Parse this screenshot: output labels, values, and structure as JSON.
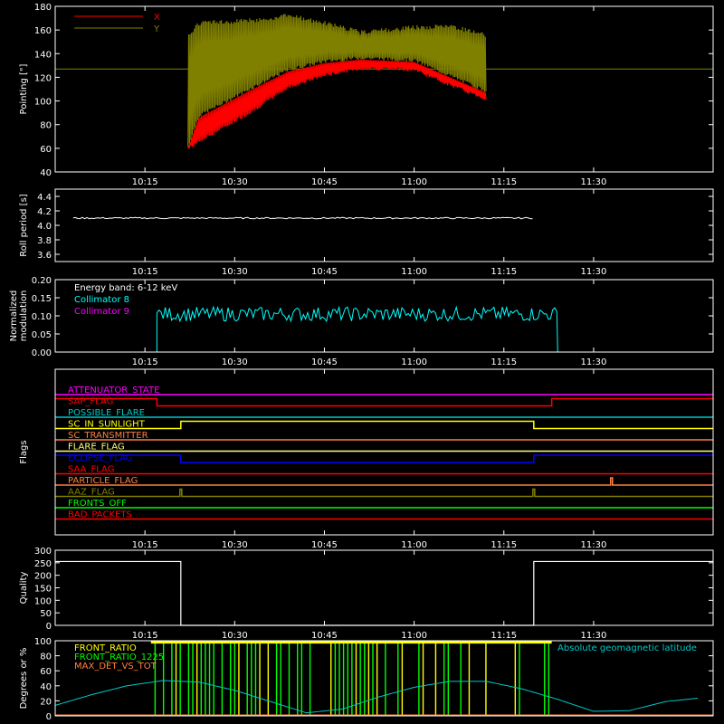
{
  "chart_data": [
    {
      "id": "pointing",
      "type": "line",
      "title": "",
      "ylabel": "Pointing [\"]",
      "ylim": [
        40,
        180
      ],
      "yticks": [
        40,
        60,
        80,
        100,
        120,
        140,
        160,
        180
      ],
      "xlim_minutes": [
        0,
        720
      ],
      "xticks": [
        "10:15",
        "10:30",
        "10:45",
        "11:00",
        "11:15",
        "11:30"
      ],
      "legend": [
        {
          "name": "X",
          "color": "#ff0000"
        },
        {
          "name": "Y",
          "color": "#808000"
        }
      ],
      "reference_line": 127,
      "series": [
        {
          "name": "Y",
          "color": "#808000",
          "upper_envelope": [
            [
              10.37,
              156
            ],
            [
              10.4,
              168
            ],
            [
              10.55,
              170
            ],
            [
              10.65,
              174
            ],
            [
              10.75,
              168
            ],
            [
              10.85,
              160
            ],
            [
              11.0,
              164
            ],
            [
              11.1,
              165
            ],
            [
              11.2,
              158
            ]
          ],
          "lower_envelope": [
            [
              10.37,
              60
            ],
            [
              10.4,
              86
            ],
            [
              10.55,
              110
            ],
            [
              10.65,
              125
            ],
            [
              10.75,
              132
            ],
            [
              10.85,
              135
            ],
            [
              11.0,
              133
            ],
            [
              11.1,
              120
            ],
            [
              11.2,
              107
            ]
          ]
        },
        {
          "name": "X",
          "color": "#ff0000",
          "upper_envelope": [
            [
              10.37,
              60
            ],
            [
              10.4,
              86
            ],
            [
              10.55,
              110
            ],
            [
              10.65,
              125
            ],
            [
              10.75,
              132
            ],
            [
              10.85,
              135
            ],
            [
              11.0,
              133
            ],
            [
              11.1,
              120
            ],
            [
              11.2,
              107
            ]
          ],
          "lower_envelope": [
            [
              10.37,
              58
            ],
            [
              10.4,
              64
            ],
            [
              10.55,
              90
            ],
            [
              10.65,
              110
            ],
            [
              10.75,
              120
            ],
            [
              10.85,
              126
            ],
            [
              11.0,
              125
            ],
            [
              11.1,
              112
            ],
            [
              11.2,
              100
            ]
          ]
        }
      ]
    },
    {
      "id": "roll",
      "type": "line",
      "ylabel": "Roll period [s]",
      "ylim": [
        3.5,
        4.5
      ],
      "yticks": [
        3.6,
        3.8,
        4.0,
        4.2,
        4.4
      ],
      "xticks": [
        "10:15",
        "10:30",
        "10:45",
        "11:00",
        "11:15",
        "11:30"
      ],
      "series": [
        {
          "name": "",
          "color": "#ffffff",
          "x_hours": [
            10.15,
            10.35,
            10.55,
            10.75,
            10.95,
            11.15,
            11.33
          ],
          "values": [
            4.1,
            4.1,
            4.1,
            4.1,
            4.1,
            4.1,
            4.1
          ]
        }
      ]
    },
    {
      "id": "modulation",
      "type": "line",
      "ylabel": "Normalized modulation",
      "ylim": [
        0,
        0.2
      ],
      "yticks": [
        0.0,
        0.05,
        0.1,
        0.15,
        0.2
      ],
      "xticks": [
        "10:15",
        "10:30",
        "10:45",
        "11:00",
        "11:15",
        "11:30"
      ],
      "annotation": "Energy band: 6-12 keV",
      "legend": [
        {
          "name": "Collimator 8",
          "color": "#00ffff"
        },
        {
          "name": "Collimator 9",
          "color": "#ff00ff"
        }
      ],
      "series": [
        {
          "name": "Collimator 8",
          "color": "#00ffff",
          "start": "10:17",
          "end": "11:24",
          "mean": 0.105,
          "range": [
            0.085,
            0.125
          ]
        },
        {
          "name": "Collimator 9",
          "color": "#ff00ff",
          "values": [
            0,
            0
          ]
        }
      ]
    },
    {
      "id": "flags",
      "type": "line",
      "ylabel": "Flags",
      "xticks": [
        "10:15",
        "10:30",
        "10:45",
        "11:00",
        "11:15",
        "11:30"
      ],
      "flags": [
        {
          "name": "ATTENUATOR_STATE",
          "color": "#ff00ff",
          "steps": []
        },
        {
          "name": "SAP_FLAG",
          "color": "#ff0000",
          "steps": [
            [
              "10:00",
              "10:17",
              1
            ],
            [
              "10:17",
              "11:23",
              0
            ],
            [
              "11:23",
              "11:50",
              1
            ]
          ]
        },
        {
          "name": "POSSIBLE_FLARE",
          "color": "#00c8c8",
          "steps": []
        },
        {
          "name": "SC_IN_SUNLIGHT",
          "color": "#ffff00",
          "steps": [
            [
              "10:00",
              "10:21",
              0
            ],
            [
              "10:21",
              "11:20",
              1
            ],
            [
              "11:20",
              "11:50",
              0
            ]
          ]
        },
        {
          "name": "SC_TRANSMITTER",
          "color": "#ff8040",
          "steps": []
        },
        {
          "name": "FLARE_FLAG",
          "color": "#ffff80",
          "steps": []
        },
        {
          "name": "ECLIPSE_FLAG",
          "color": "#0000ff",
          "steps": [
            [
              "10:00",
              "10:21",
              1
            ],
            [
              "10:21",
              "11:20",
              0
            ],
            [
              "11:20",
              "11:50",
              1
            ]
          ]
        },
        {
          "name": "SAA_FLAG",
          "color": "#ff0000",
          "steps": []
        },
        {
          "name": "PARTICLE_FLAG",
          "color": "#ff8040",
          "spikes": [
            "11:33"
          ]
        },
        {
          "name": "AAZ_FLAG",
          "color": "#808000",
          "spikes": [
            "10:21",
            "11:20"
          ]
        },
        {
          "name": "FRONTS_OFF",
          "color": "#00ff00",
          "steps": []
        },
        {
          "name": "BAD_PACKETS",
          "color": "#ff0000",
          "steps": []
        }
      ]
    },
    {
      "id": "quality",
      "type": "line",
      "ylabel": "Quality",
      "ylim": [
        0,
        300
      ],
      "yticks": [
        0,
        50,
        100,
        150,
        200,
        250,
        300
      ],
      "xticks": [
        "10:15",
        "10:30",
        "10:45",
        "11:00",
        "11:15",
        "11:30"
      ],
      "series": [
        {
          "name": "",
          "color": "#ffffff",
          "steps": [
            [
              "10:00",
              "10:21",
              255
            ],
            [
              "10:21",
              "11:20",
              0
            ],
            [
              "11:20",
              "11:50",
              255
            ]
          ]
        }
      ]
    },
    {
      "id": "ratios",
      "type": "line",
      "ylabel": "Degrees or %",
      "ylim": [
        0,
        100
      ],
      "yticks": [
        0,
        20,
        40,
        60,
        80,
        100
      ],
      "legend": [
        {
          "name": "FRONT_RATIO",
          "color": "#ffff00"
        },
        {
          "name": "FRONT_RATIO_1225",
          "color": "#00ff00"
        },
        {
          "name": "MAX_DET_VS_TOT",
          "color": "#ff8040"
        }
      ],
      "annotation": "Absolute geomagnetic latitude",
      "series": [
        {
          "name": "Absolute geomagnetic latitude",
          "color": "#00c8c8",
          "x_hours": [
            10.0,
            10.1,
            10.2,
            10.3,
            10.4,
            10.5,
            10.6,
            10.7,
            10.8,
            10.9,
            11.0,
            11.1,
            11.2,
            11.3,
            11.4,
            11.5,
            11.6,
            11.7,
            11.8
          ],
          "values": [
            14,
            28,
            40,
            47,
            45,
            34,
            19,
            4,
            9,
            25,
            38,
            46,
            46,
            36,
            22,
            6,
            7,
            19,
            24
          ]
        },
        {
          "name": "FRONT_RATIO",
          "color": "#ffff00",
          "start": "10:16",
          "end": "11:23",
          "value_range": [
            0,
            100
          ]
        },
        {
          "name": "FRONT_RATIO_1225",
          "color": "#00ff00",
          "start": "10:16",
          "end": "11:23",
          "value_range": [
            0,
            100
          ]
        },
        {
          "name": "MAX_DET_VS_TOT",
          "color": "#ff8040",
          "values": [
            0
          ]
        }
      ]
    }
  ]
}
